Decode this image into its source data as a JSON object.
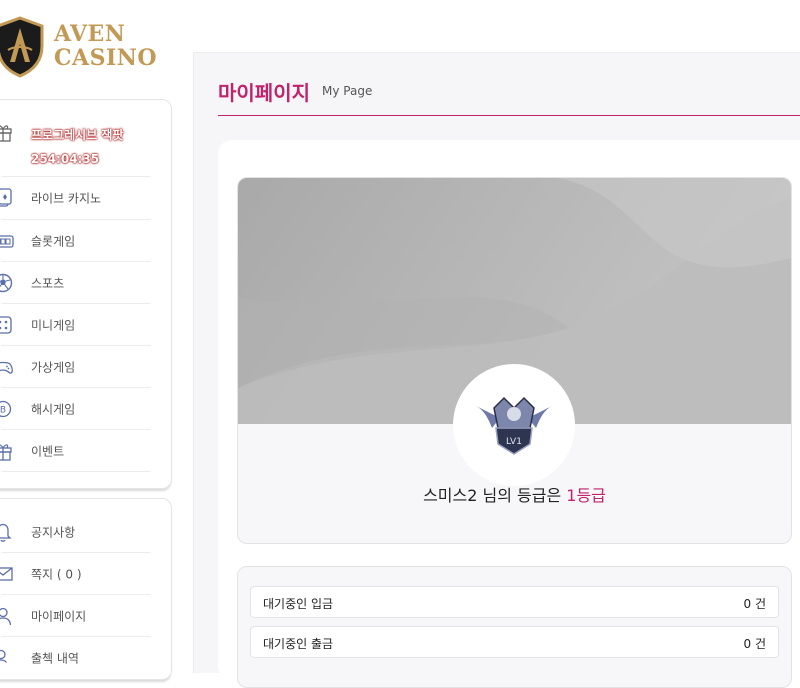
{
  "logo": {
    "line1": "AVEN",
    "line2": "CASINO"
  },
  "sidebar": {
    "promo": {
      "label": "프로그레시브 잭팟",
      "timer": "254:04:35"
    },
    "items": [
      {
        "label": "라이브 카지노",
        "icon": "live-casino-card-icon"
      },
      {
        "label": "슬롯게임",
        "icon": "slot-machine-icon"
      },
      {
        "label": "스포츠",
        "icon": "soccer-ball-icon"
      },
      {
        "label": "미니게임",
        "icon": "dice-icon"
      },
      {
        "label": "가상게임",
        "icon": "gamepad-icon"
      },
      {
        "label": "해시게임",
        "icon": "bitcoin-coin-icon"
      },
      {
        "label": "이벤트",
        "icon": "gift-icon"
      }
    ],
    "items2": [
      {
        "label": "공지사항",
        "icon": "bell-icon"
      },
      {
        "label": "쪽지 ( 0 )",
        "icon": "envelope-icon"
      },
      {
        "label": "마이페이지",
        "icon": "user-icon"
      },
      {
        "label": "출첵 내역",
        "icon": "user-check-icon"
      }
    ]
  },
  "main": {
    "title": "마이페이지",
    "subtitle": "My Page",
    "profile": {
      "badge_text": "LV1",
      "grade_prefix": "스미스2 님의 등급은 ",
      "grade_value": "1등급"
    },
    "stats": [
      {
        "label": "대기중인 입금",
        "value": "0 건"
      },
      {
        "label": "대기중인 출금",
        "value": "0 건"
      }
    ]
  },
  "colors": {
    "accent": "#c0236b",
    "gold": "#c39a55",
    "banner": "#b8b8b8"
  }
}
